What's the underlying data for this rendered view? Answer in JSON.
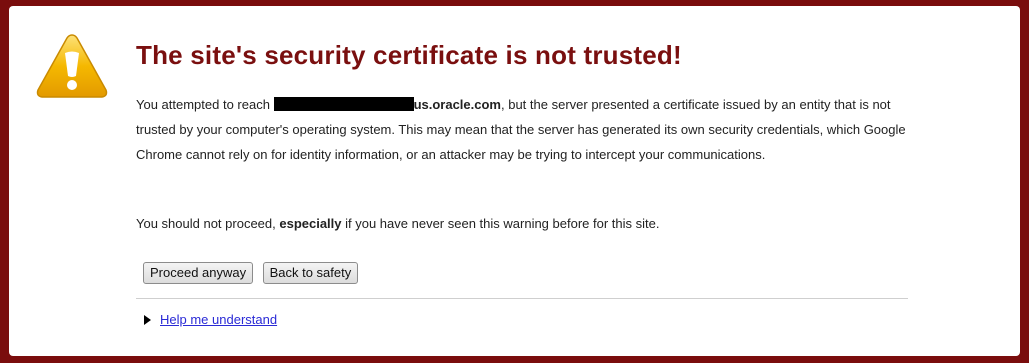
{
  "page": {
    "title": "The site's security certificate is not trusted!",
    "main_paragraph": {
      "before": "You attempted to reach ",
      "host": "us.oracle.com",
      "after_line1": ", but the server presented a certificate issued by",
      "rest": "an entity that is not trusted by your computer's operating system. This may mean that the server has generated its own security credentials, which Google Chrome cannot rely on for identity information, or an attacker may be trying to intercept your communications."
    },
    "advice": {
      "before": "You should not proceed, ",
      "emphasis": "especially",
      "after": " if you have never seen this warning before for this site."
    },
    "buttons": {
      "proceed": "Proceed anyway",
      "back": "Back to safety"
    },
    "help_link": "Help me understand"
  },
  "colors": {
    "background": "#7a0d0d",
    "title": "#7a0f0f",
    "link": "#2a2ad6",
    "warning_icon": "#f2b705"
  },
  "icons": {
    "warning": "warning-triangle-icon",
    "disclosure": "triangle-right-icon"
  }
}
